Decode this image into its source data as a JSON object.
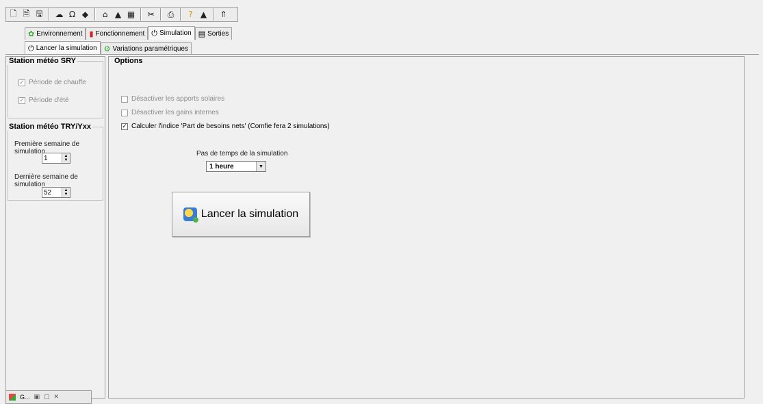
{
  "toolbar": {
    "buttons": [
      "new-doc-icon",
      "open-doc-icon",
      "save-icon",
      "weather-icon",
      "material-icon",
      "diamond-icon",
      "house-icon",
      "wall-icon",
      "chart-icon",
      "tools-icon",
      "print-icon",
      "help-icon",
      "info-icon",
      "exit-icon"
    ]
  },
  "main_tabs": [
    {
      "label": "Environnement"
    },
    {
      "label": "Fonctionnement"
    },
    {
      "label": "Simulation"
    },
    {
      "label": "Sorties"
    }
  ],
  "sub_tabs": [
    {
      "label": "Lancer la simulation"
    },
    {
      "label": "Variations paramétriques"
    }
  ],
  "left": {
    "sry_title": "Station météo SRY",
    "sry_checks": [
      {
        "label": "Période de chauffe",
        "checked": true
      },
      {
        "label": "Période d'été",
        "checked": true
      }
    ],
    "try_title": "Station météo TRY/Yxx",
    "first_week_label": "Première semaine de simulation",
    "first_week_value": "1",
    "last_week_label": "Dernière semaine de simulation",
    "last_week_value": "52"
  },
  "options": {
    "title": "Options",
    "checks": [
      {
        "label": "Désactiver les apports solaires",
        "checked": false
      },
      {
        "label": "Désactiver les gains internes",
        "checked": false
      },
      {
        "label": "Calculer l'indice 'Part de besoins nets' (Comfie fera 2 simulations)",
        "checked": true
      }
    ],
    "timestep_label": "Pas de temps de la simulation",
    "timestep_value": "1 heure",
    "launch_label": "Lancer la simulation"
  },
  "taskbar": {
    "label": "G..."
  }
}
